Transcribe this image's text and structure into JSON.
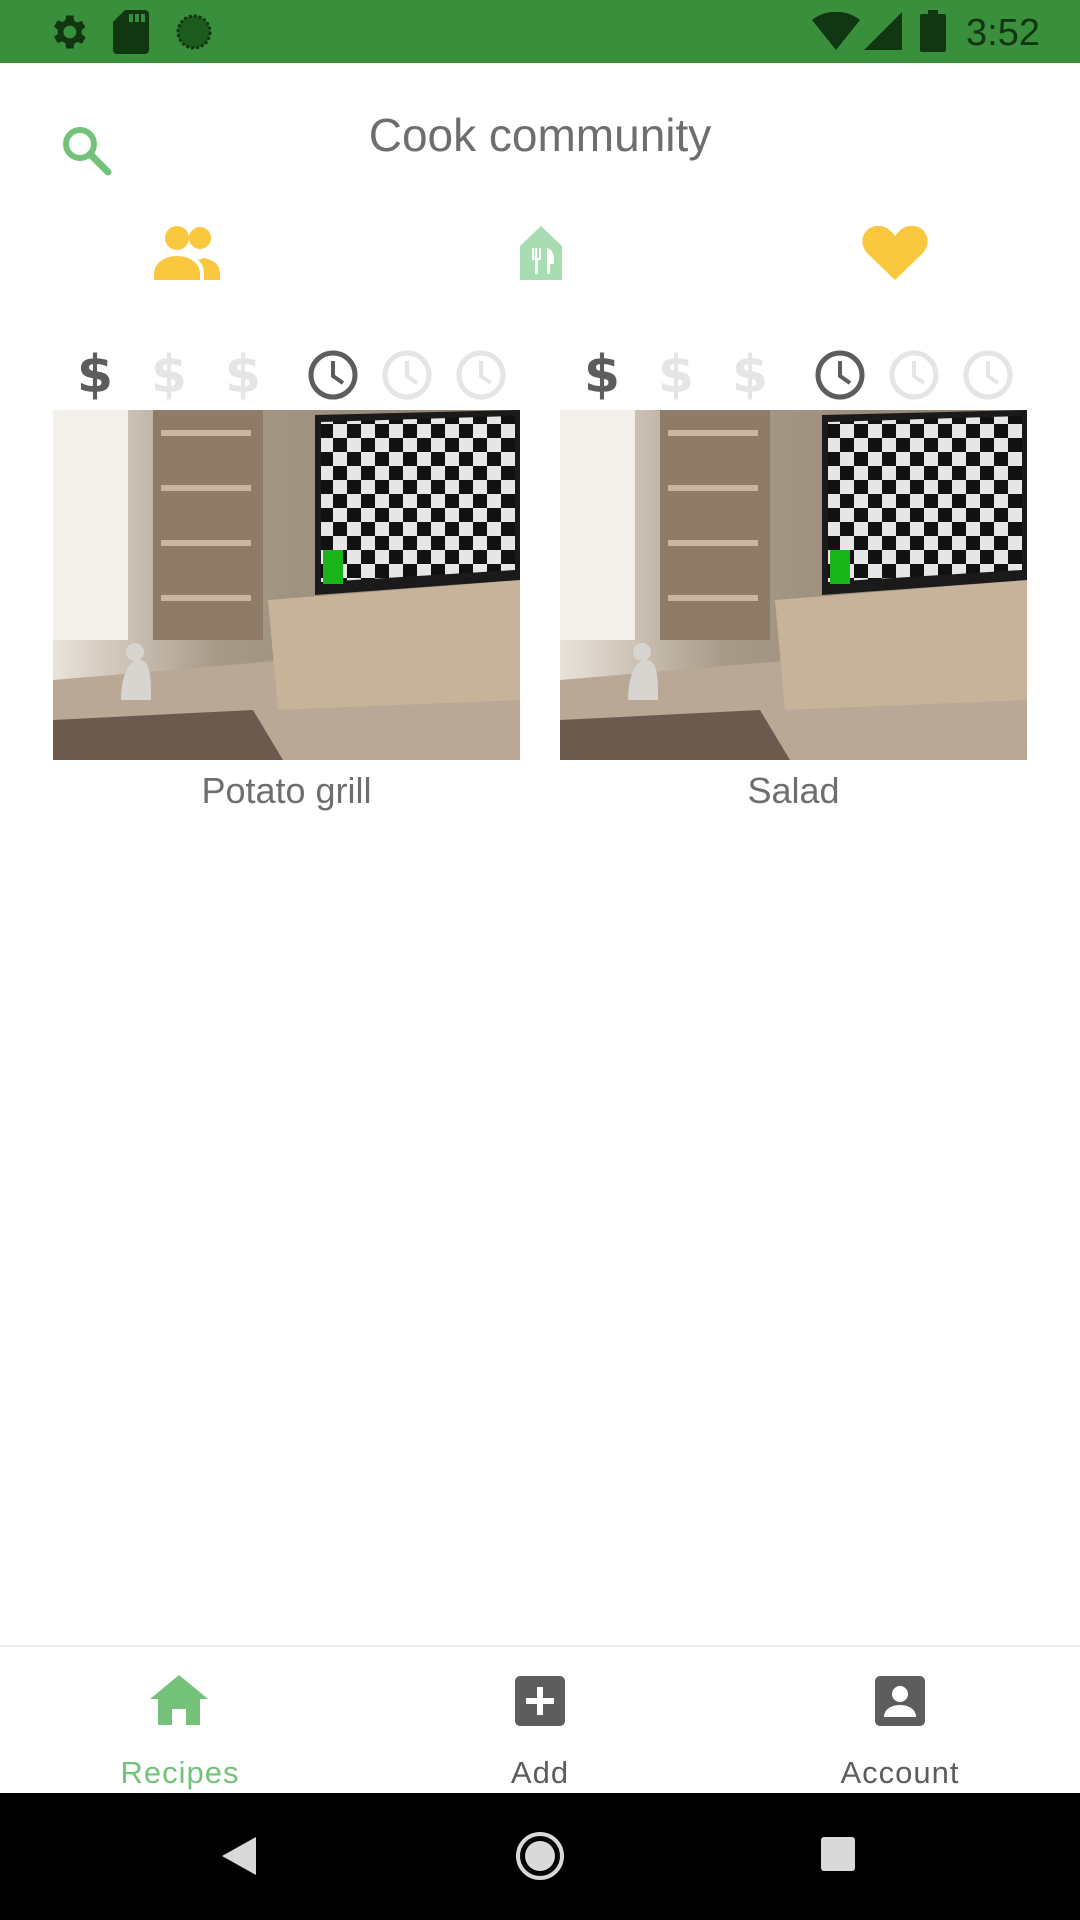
{
  "status_bar": {
    "time": "3:52",
    "left_icons": [
      "settings-icon",
      "sd-card-icon",
      "sync-icon"
    ],
    "right_icons": [
      "wifi-icon",
      "signal-icon",
      "battery-icon"
    ],
    "color": "#3a8f3c"
  },
  "header": {
    "title": "Cook community",
    "search_icon": "search-icon"
  },
  "filter_tabs": [
    {
      "icon": "people-icon",
      "color": "#f9c83f",
      "active": true
    },
    {
      "icon": "restaurant-icon",
      "color": "#a9dcb0",
      "active": false
    },
    {
      "icon": "heart-icon",
      "color": "#f9c83f",
      "active": true
    }
  ],
  "recipes": [
    {
      "name": "Potato grill",
      "price_level": 1,
      "price_max": 3,
      "time_level": 1,
      "time_max": 3,
      "image": "room-photo"
    },
    {
      "name": "Salad",
      "price_level": 1,
      "price_max": 3,
      "time_level": 1,
      "time_max": 3,
      "image": "room-photo"
    }
  ],
  "bottom_nav": {
    "items": [
      {
        "label": "Recipes",
        "icon": "home-icon",
        "active": true
      },
      {
        "label": "Add",
        "icon": "add-box-icon",
        "active": false
      },
      {
        "label": "Account",
        "icon": "account-box-icon",
        "active": false
      }
    ],
    "active_color": "#74c17a",
    "inactive_color": "#5d5d5d"
  },
  "system_nav": [
    "back-icon",
    "home-circle-icon",
    "recents-icon"
  ]
}
